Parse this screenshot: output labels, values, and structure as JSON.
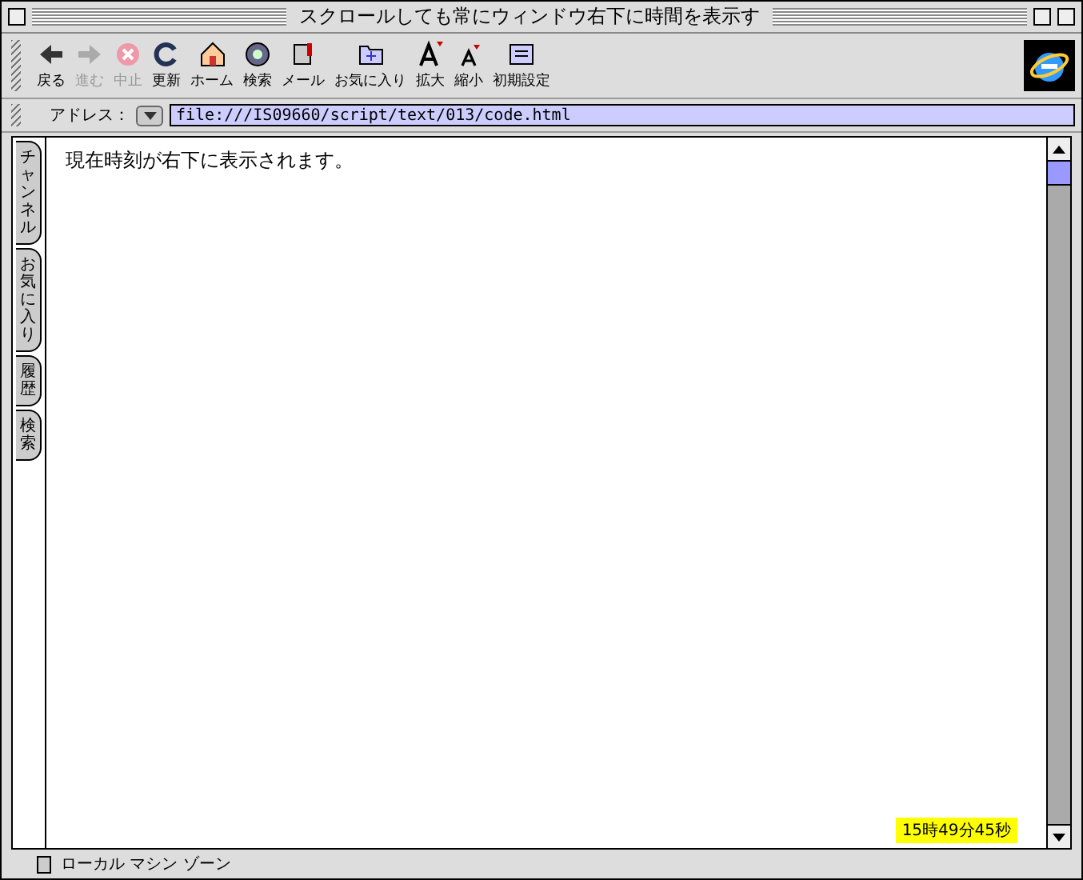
{
  "window": {
    "title": "スクロールしても常にウィンドウ右下に時間を表示す"
  },
  "toolbar": [
    {
      "kind": "back",
      "label": "戻る",
      "disabled": false
    },
    {
      "kind": "forward",
      "label": "進む",
      "disabled": true
    },
    {
      "kind": "stop",
      "label": "中止",
      "disabled": true
    },
    {
      "kind": "refresh",
      "label": "更新",
      "disabled": false
    },
    {
      "kind": "home",
      "label": "ホーム",
      "disabled": false
    },
    {
      "kind": "search",
      "label": "検索",
      "disabled": false
    },
    {
      "kind": "mail",
      "label": "メール",
      "disabled": false
    },
    {
      "kind": "favorites",
      "label": "お気に入り",
      "disabled": false
    },
    {
      "kind": "larger",
      "label": "拡大",
      "disabled": false
    },
    {
      "kind": "smaller",
      "label": "縮小",
      "disabled": false
    },
    {
      "kind": "preferences",
      "label": "初期設定",
      "disabled": false
    }
  ],
  "address": {
    "label": "アドレス：",
    "value": "file:///IS09660/script/text/013/code.html"
  },
  "side_tabs": [
    {
      "label": "チャンネル"
    },
    {
      "label": "お気に入り"
    },
    {
      "label": "履歴"
    },
    {
      "label": "検索"
    }
  ],
  "content": {
    "text": "現在時刻が右下に表示されます。",
    "clock": "15時49分45秒"
  },
  "status_bar": {
    "zone": "ローカル マシン ゾーン"
  }
}
